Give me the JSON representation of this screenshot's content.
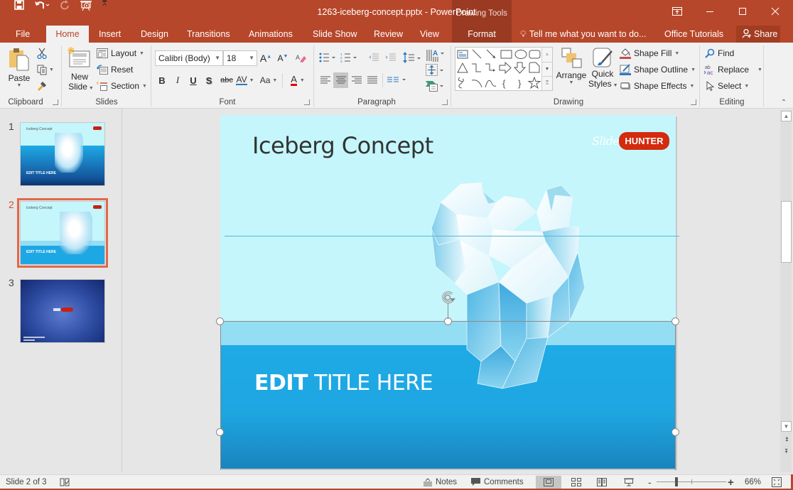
{
  "app": {
    "document_title": "1263-iceberg-concept.pptx - PowerPoint",
    "contextual_tab_group": "Drawing Tools",
    "quick_access": [
      "save-icon",
      "undo-icon",
      "redo-icon",
      "start-from-beginning-icon",
      "customize-quick-access-icon"
    ]
  },
  "window_controls": {
    "ribbon_display_options": "ribbon-display-options-icon",
    "minimize": "minimize-icon",
    "maximize": "maximize-icon",
    "close": "close-icon"
  },
  "tabs": [
    {
      "label": "File",
      "active": false
    },
    {
      "label": "Home",
      "active": true
    },
    {
      "label": "Insert",
      "active": false
    },
    {
      "label": "Design",
      "active": false
    },
    {
      "label": "Transitions",
      "active": false
    },
    {
      "label": "Animations",
      "active": false
    },
    {
      "label": "Slide Show",
      "active": false
    },
    {
      "label": "Review",
      "active": false
    },
    {
      "label": "View",
      "active": false
    },
    {
      "label": "Format",
      "active": false
    }
  ],
  "tell_me": {
    "placeholder": "Tell me what you want to do..."
  },
  "account": {
    "office_tutorials": "Office Tutorials",
    "share": "Share"
  },
  "ribbon": {
    "clipboard": {
      "label": "Clipboard",
      "paste": "Paste"
    },
    "slides": {
      "label": "Slides",
      "new_slide_1": "New",
      "new_slide_2": "Slide",
      "layout": "Layout",
      "reset": "Reset",
      "section": "Section"
    },
    "font": {
      "label": "Font",
      "font_name": "Calibri (Body)",
      "font_size": "18",
      "bold": "B",
      "italic": "I",
      "underline": "U",
      "shadow": "S",
      "strikethrough": "abc",
      "char_spacing": "AV",
      "change_case": "Aa",
      "font_color": "A",
      "font_color_hex": "#e00000"
    },
    "paragraph": {
      "label": "Paragraph"
    },
    "drawing": {
      "label": "Drawing",
      "arrange": "Arrange",
      "quick_styles_1": "Quick",
      "quick_styles_2": "Styles",
      "shape_fill": "Shape Fill",
      "shape_outline": "Shape Outline",
      "shape_effects": "Shape Effects"
    },
    "editing": {
      "label": "Editing",
      "find": "Find",
      "replace": "Replace",
      "select": "Select"
    }
  },
  "thumbnails": [
    {
      "number": "1",
      "title": "Iceberg Concept",
      "subtitle": "EDIT TITLE HERE",
      "selected": false
    },
    {
      "number": "2",
      "title": "Iceberg Concept",
      "subtitle": "EDIT TITLE HERE",
      "selected": true
    },
    {
      "number": "3",
      "title": "",
      "subtitle": "",
      "selected": false
    }
  ],
  "slide": {
    "title": "Iceberg Concept",
    "logo_slide": "Slide",
    "logo_hunter": "HUNTER",
    "edit_title_bold": "EDIT",
    "edit_title_rest": " TITLE HERE"
  },
  "status": {
    "slide_indicator": "Slide 2 of 3",
    "notes": "Notes",
    "comments": "Comments",
    "zoom_minus": "-",
    "zoom_plus": "+",
    "zoom_level": "66%"
  },
  "colors": {
    "accent": "#b7472a",
    "ribbon_bg": "#f1f1f1",
    "selected_thumb": "#e0694a"
  }
}
